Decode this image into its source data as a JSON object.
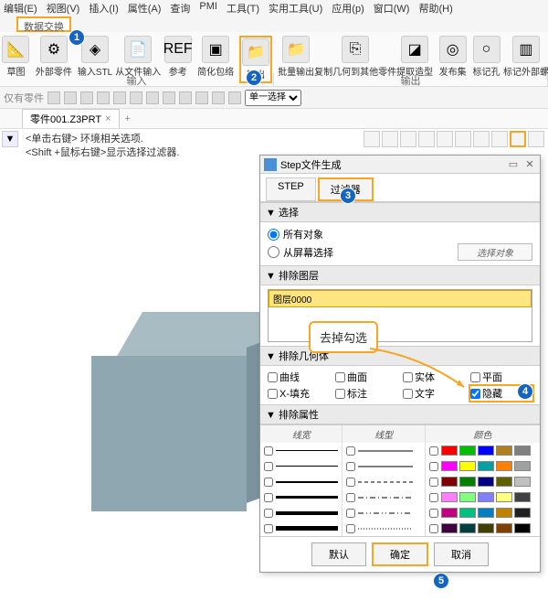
{
  "menu": {
    "edit": "编辑(E)",
    "view": "视图(V)",
    "insert": "插入(I)",
    "attr": "属性(A)",
    "query": "查询",
    "pmi": "PMI",
    "tool": "工具(T)",
    "util": "实用工具(U)",
    "app": "应用(p)",
    "win": "窗口(W)",
    "help": "帮助(H)"
  },
  "tabs": {
    "data_exchange": "数据交换"
  },
  "ribbon": {
    "import_draft": "草图",
    "ext_part": "外部零件",
    "imp_stl": "输入STL",
    "from_file": "从文件输入",
    "ref": "参考",
    "simp": "简化包络",
    "export": "输出",
    "batch_exp": "批量输出",
    "copy_geom": "复制几何到其他零件",
    "extract": "提取造型",
    "pub_set": "发布集",
    "mark_hole": "标记孔",
    "mark_ext": "标记外部螺",
    "grp_in": "输入",
    "grp_out": "输出"
  },
  "qbar": {
    "only_part": "仅有零件",
    "sel_mode": "单一选择"
  },
  "doc": {
    "tab": "零件001.Z3PRT"
  },
  "hints": {
    "l1": "<单击右键> 环境相关选项.",
    "l2": "<Shift +鼠标右键>显示选择过滤器."
  },
  "panel": {
    "title": "Step文件生成",
    "tab_step": "STEP",
    "tab_filter": "过滤器",
    "sect_select": "▼ 选择",
    "opt_all": "所有对象",
    "opt_screen": "从屏幕选择",
    "pick": "选择对象",
    "sect_layer": "▼ 排除图层",
    "layer0": "图层0000",
    "sect_geom": "▼ 排除几何体",
    "g_curve": "曲线",
    "g_surf": "曲面",
    "g_solid": "实体",
    "g_plane": "平面",
    "g_xfill": "X-填充",
    "g_label": "标注",
    "g_text": "文字",
    "g_hidden": "隐藏",
    "sect_attr": "▼ 排除属性",
    "a_lw": "线宽",
    "a_ls": "线型",
    "a_color": "颜色",
    "btn_default": "默认",
    "btn_ok": "确定",
    "btn_cancel": "取消"
  },
  "annot": {
    "uncheck": "去掉勾选"
  },
  "badges": {
    "b1": "1",
    "b2": "2",
    "b3": "3",
    "b4": "4",
    "b5": "5"
  },
  "chart_data": {
    "line_weights": [
      1,
      1.5,
      2,
      3,
      4,
      5
    ],
    "line_styles": [
      "solid",
      "solid",
      "dash",
      "dashdot",
      "dashdotdot",
      "dot"
    ],
    "color_swatches": [
      [
        "#ff0000",
        "#00c000",
        "#0000ff",
        "#b08020",
        "#808080"
      ],
      [
        "#ff00ff",
        "#ffff00",
        "#00a0a0",
        "#ff8000",
        "#a0a0a0"
      ],
      [
        "#800000",
        "#008000",
        "#000080",
        "#606000",
        "#c0c0c0"
      ],
      [
        "#ff80ff",
        "#80ff80",
        "#8080ff",
        "#ffff80",
        "#404040"
      ],
      [
        "#c00080",
        "#00c080",
        "#0080c0",
        "#c08000",
        "#202020"
      ],
      [
        "#400040",
        "#004040",
        "#404000",
        "#804000",
        "#000000"
      ]
    ]
  }
}
